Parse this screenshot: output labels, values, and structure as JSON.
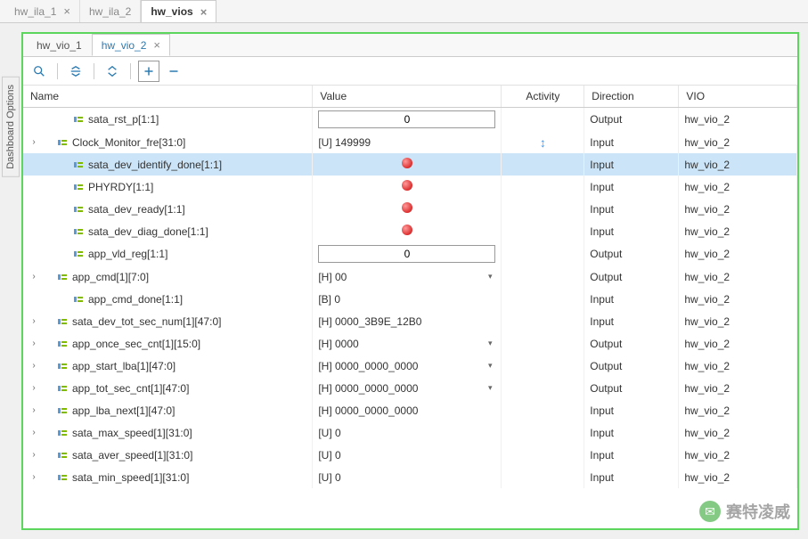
{
  "outer_tabs": [
    {
      "label": "hw_ila_1",
      "active": false,
      "closable": true
    },
    {
      "label": "hw_ila_2",
      "active": false,
      "closable": false
    },
    {
      "label": "hw_vios",
      "active": true,
      "closable": true
    }
  ],
  "sidebar_label": "Dashboard Options",
  "inner_tabs": [
    {
      "label": "hw_vio_1",
      "active": false,
      "closable": false
    },
    {
      "label": "hw_vio_2",
      "active": true,
      "closable": true
    }
  ],
  "toolbar": {
    "search": "Q",
    "collapse": "⇆",
    "sort": "◆",
    "add": "＋",
    "remove": "—"
  },
  "columns": {
    "name": "Name",
    "value": "Value",
    "activity": "Activity",
    "direction": "Direction",
    "vio": "VIO"
  },
  "rows": [
    {
      "indent": 1,
      "expand": "",
      "name": "sata_rst_p[1:1]",
      "value_type": "input",
      "value": "0",
      "activity": "",
      "direction": "Output",
      "vio": "hw_vio_2",
      "selected": false
    },
    {
      "indent": 0,
      "expand": ">",
      "name": "Clock_Monitor_fre[31:0]",
      "value_type": "text",
      "value": "[U] 149999",
      "activity": "updown",
      "direction": "Input",
      "vio": "hw_vio_2",
      "selected": false
    },
    {
      "indent": 1,
      "expand": "",
      "name": "sata_dev_identify_done[1:1]",
      "value_type": "led",
      "value": "",
      "activity": "",
      "direction": "Input",
      "vio": "hw_vio_2",
      "selected": true
    },
    {
      "indent": 1,
      "expand": "",
      "name": "PHYRDY[1:1]",
      "value_type": "led",
      "value": "",
      "activity": "",
      "direction": "Input",
      "vio": "hw_vio_2",
      "selected": false
    },
    {
      "indent": 1,
      "expand": "",
      "name": "sata_dev_ready[1:1]",
      "value_type": "led",
      "value": "",
      "activity": "",
      "direction": "Input",
      "vio": "hw_vio_2",
      "selected": false
    },
    {
      "indent": 1,
      "expand": "",
      "name": "sata_dev_diag_done[1:1]",
      "value_type": "led",
      "value": "",
      "activity": "",
      "direction": "Input",
      "vio": "hw_vio_2",
      "selected": false
    },
    {
      "indent": 1,
      "expand": "",
      "name": "app_vld_reg[1:1]",
      "value_type": "input",
      "value": "0",
      "activity": "",
      "direction": "Output",
      "vio": "hw_vio_2",
      "selected": false
    },
    {
      "indent": 0,
      "expand": ">",
      "name": "app_cmd[1][7:0]",
      "value_type": "dropdown",
      "value": "[H] 00",
      "activity": "",
      "direction": "Output",
      "vio": "hw_vio_2",
      "selected": false
    },
    {
      "indent": 1,
      "expand": "",
      "name": "app_cmd_done[1:1]",
      "value_type": "text",
      "value": "[B] 0",
      "activity": "",
      "direction": "Input",
      "vio": "hw_vio_2",
      "selected": false
    },
    {
      "indent": 0,
      "expand": ">",
      "name": "sata_dev_tot_sec_num[1][47:0]",
      "value_type": "text",
      "value": "[H] 0000_3B9E_12B0",
      "activity": "",
      "direction": "Input",
      "vio": "hw_vio_2",
      "selected": false
    },
    {
      "indent": 0,
      "expand": ">",
      "name": "app_once_sec_cnt[1][15:0]",
      "value_type": "dropdown",
      "value": "[H] 0000",
      "activity": "",
      "direction": "Output",
      "vio": "hw_vio_2",
      "selected": false
    },
    {
      "indent": 0,
      "expand": ">",
      "name": "app_start_lba[1][47:0]",
      "value_type": "dropdown",
      "value": "[H] 0000_0000_0000",
      "activity": "",
      "direction": "Output",
      "vio": "hw_vio_2",
      "selected": false
    },
    {
      "indent": 0,
      "expand": ">",
      "name": "app_tot_sec_cnt[1][47:0]",
      "value_type": "dropdown",
      "value": "[H] 0000_0000_0000",
      "activity": "",
      "direction": "Output",
      "vio": "hw_vio_2",
      "selected": false
    },
    {
      "indent": 0,
      "expand": ">",
      "name": "app_lba_next[1][47:0]",
      "value_type": "text",
      "value": "[H] 0000_0000_0000",
      "activity": "",
      "direction": "Input",
      "vio": "hw_vio_2",
      "selected": false
    },
    {
      "indent": 0,
      "expand": ">",
      "name": "sata_max_speed[1][31:0]",
      "value_type": "text",
      "value": "[U] 0",
      "activity": "",
      "direction": "Input",
      "vio": "hw_vio_2",
      "selected": false
    },
    {
      "indent": 0,
      "expand": ">",
      "name": "sata_aver_speed[1][31:0]",
      "value_type": "text",
      "value": "[U] 0",
      "activity": "",
      "direction": "Input",
      "vio": "hw_vio_2",
      "selected": false
    },
    {
      "indent": 0,
      "expand": ">",
      "name": "sata_min_speed[1][31:0]",
      "value_type": "text",
      "value": "[U] 0",
      "activity": "",
      "direction": "Input",
      "vio": "hw_vio_2",
      "selected": false
    }
  ],
  "watermark": "赛特凌威"
}
